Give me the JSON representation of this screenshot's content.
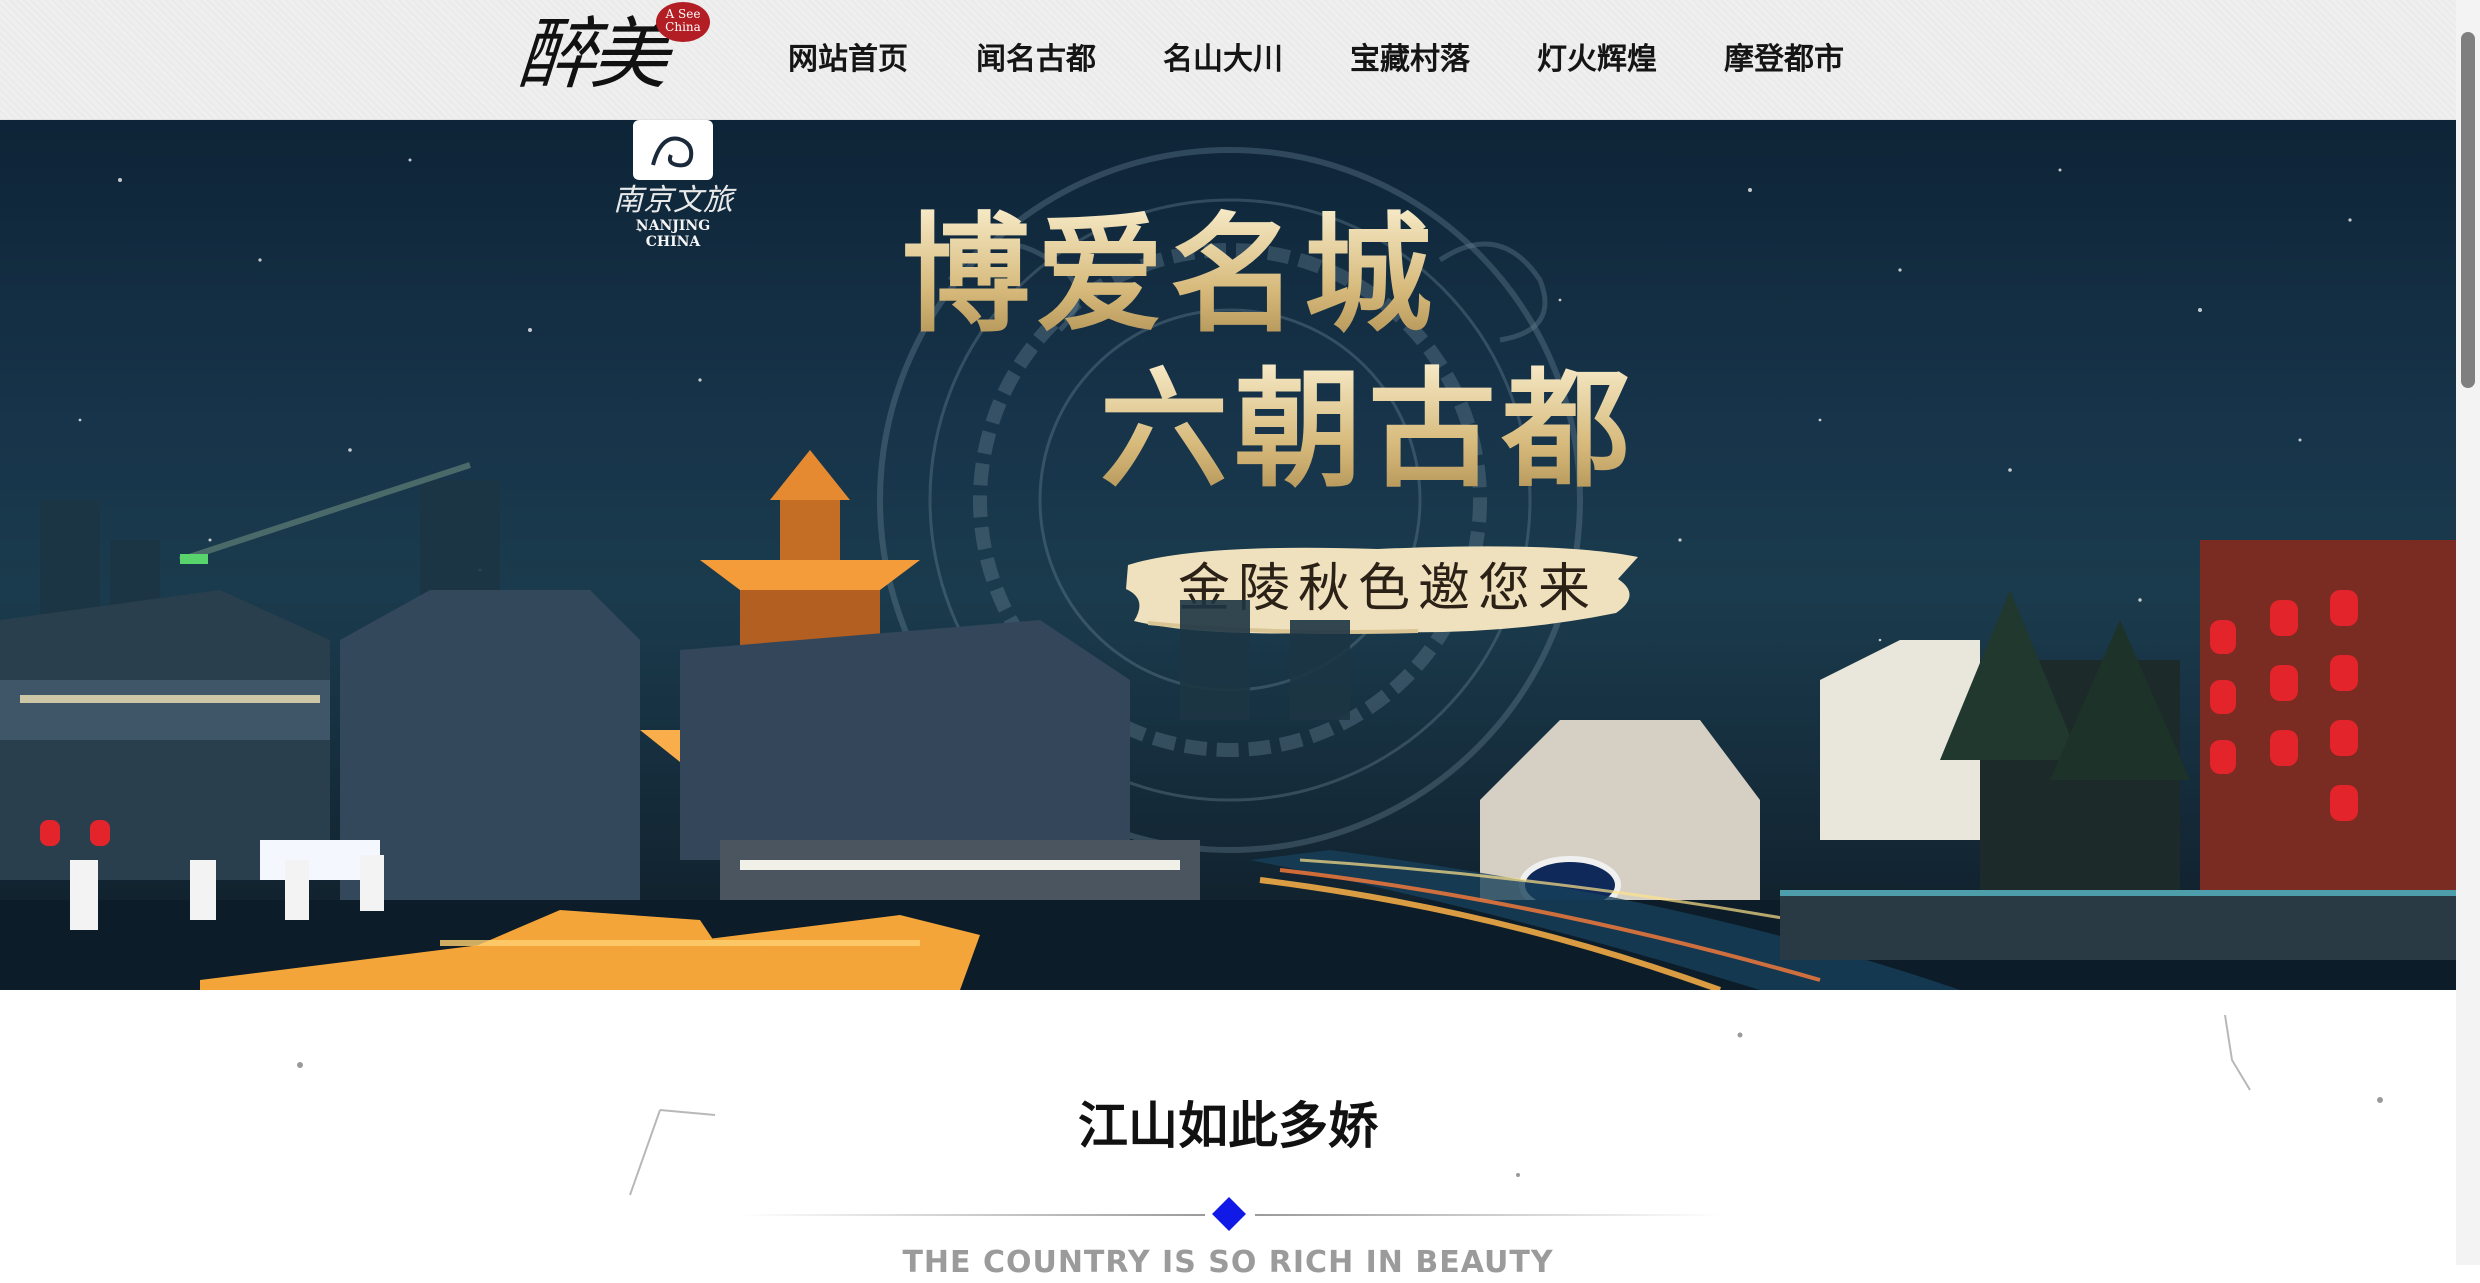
{
  "header": {
    "logo_text": "醉美中国",
    "logo_seal": "A See China",
    "nav": [
      {
        "label": "网站首页"
      },
      {
        "label": "闻名古都"
      },
      {
        "label": "名山大川"
      },
      {
        "label": "宝藏村落"
      },
      {
        "label": "灯火辉煌"
      },
      {
        "label": "摩登都市"
      }
    ]
  },
  "banner": {
    "brand_cn": "南京文旅",
    "brand_en": "NANJING CHINA",
    "headline_1": "博爱名城",
    "headline_2": "六朝古都",
    "tagline": "金陵秋色邀您来"
  },
  "section": {
    "title": "江山如此多娇",
    "subtitle": "THE COUNTRY IS SO RICH IN BEAUTY"
  },
  "colors": {
    "divider_diamond": "#1019e6",
    "header_bg": "#efefef",
    "headline_gold": "#e3cf9e",
    "lantern_red": "#e3242b"
  },
  "icons": {
    "scroll": "scrollbar-thumb",
    "divider": "diamond-icon"
  }
}
